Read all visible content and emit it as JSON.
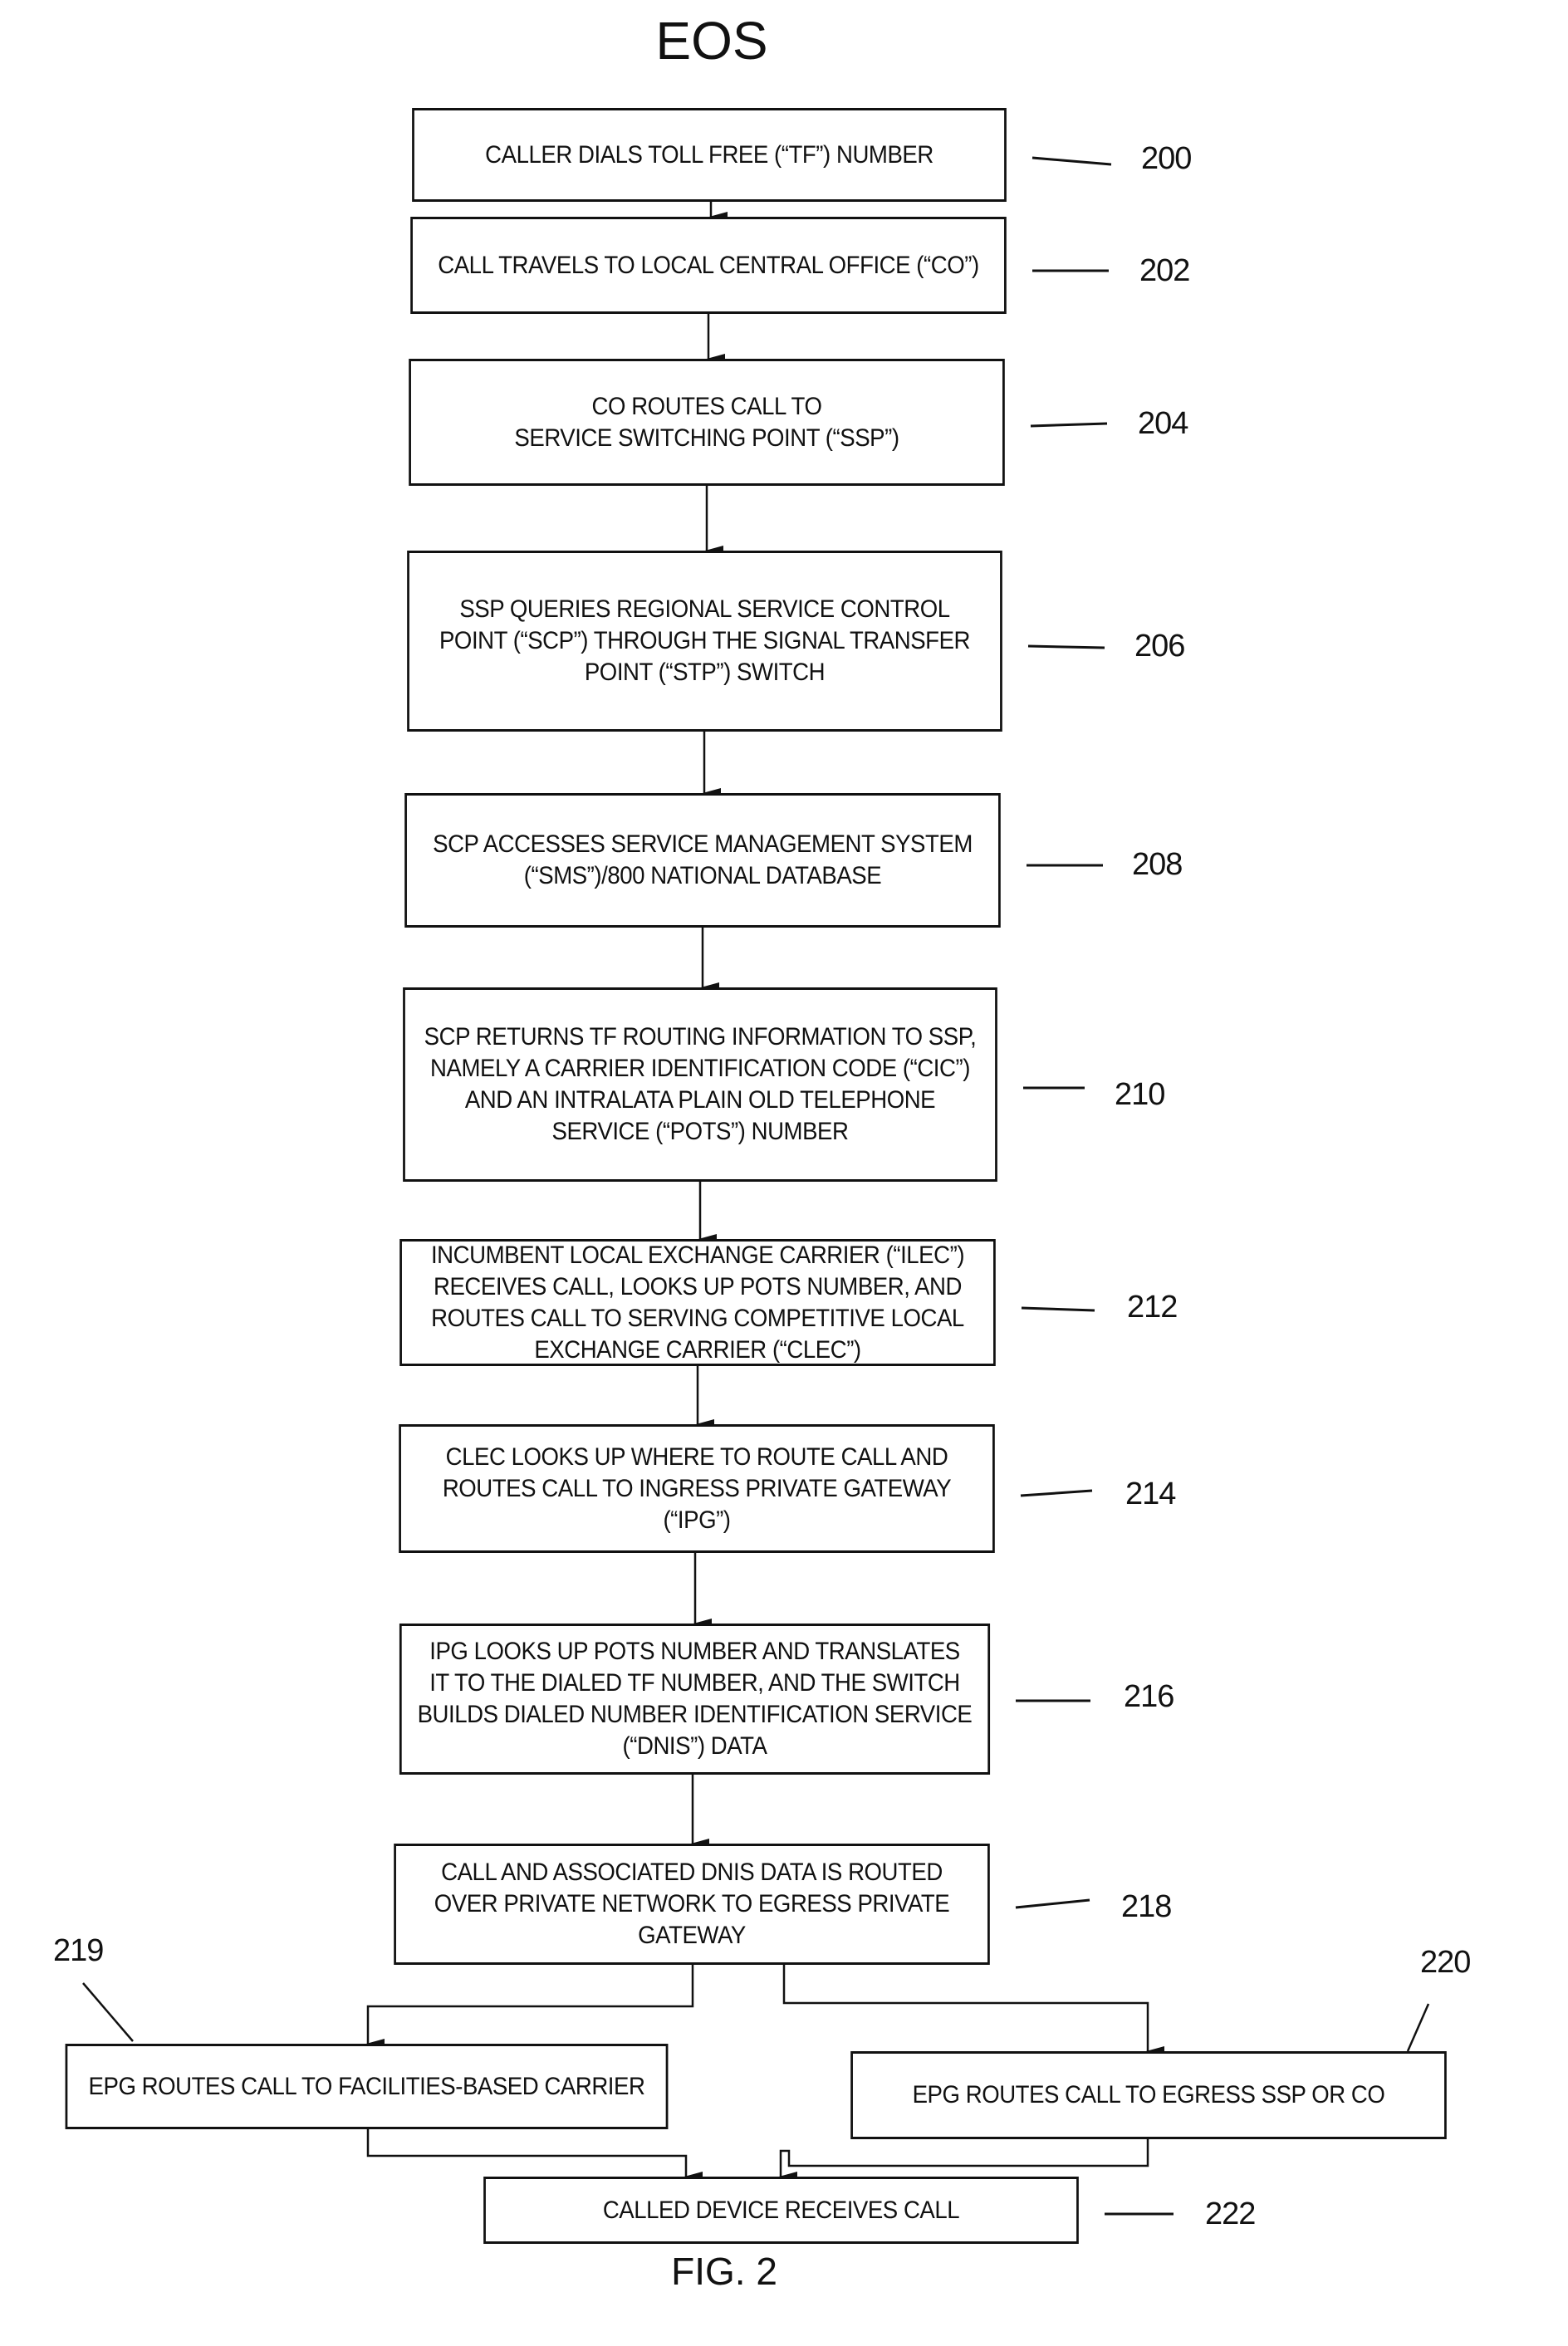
{
  "title": "EOS",
  "figure_label": "FIG. 2",
  "steps": [
    {
      "ref": "200",
      "text": "CALLER DIALS TOLL FREE (“TF”) NUMBER"
    },
    {
      "ref": "202",
      "text": "CALL TRAVELS TO LOCAL CENTRAL OFFICE (“CO”)"
    },
    {
      "ref": "204",
      "text": "CO ROUTES CALL TO\nSERVICE SWITCHING POINT (“SSP”)"
    },
    {
      "ref": "206",
      "text": "SSP QUERIES REGIONAL SERVICE CONTROL\nPOINT (“SCP”) THROUGH THE SIGNAL TRANSFER\nPOINT (“STP”) SWITCH"
    },
    {
      "ref": "208",
      "text": "SCP ACCESSES SERVICE MANAGEMENT SYSTEM\n(“SMS”)/800 NATIONAL DATABASE"
    },
    {
      "ref": "210",
      "text": "SCP RETURNS TF ROUTING INFORMATION TO SSP,\nNAMELY A CARRIER IDENTIFICATION CODE (“CIC”)\nAND AN INTRALATA PLAIN OLD TELEPHONE\nSERVICE (“POTS”) NUMBER"
    },
    {
      "ref": "212",
      "text": "INCUMBENT LOCAL EXCHANGE CARRIER (“ILEC”)\nRECEIVES CALL, LOOKS UP POTS NUMBER, AND\nROUTES CALL TO SERVING COMPETITIVE LOCAL\nEXCHANGE CARRIER (“CLEC”)"
    },
    {
      "ref": "214",
      "text": "CLEC LOOKS UP WHERE TO ROUTE CALL AND\nROUTES CALL TO INGRESS PRIVATE GATEWAY\n(“IPG”)"
    },
    {
      "ref": "216",
      "text": "IPG LOOKS UP POTS NUMBER AND TRANSLATES\nIT TO THE DIALED TF NUMBER, AND THE SWITCH\nBUILDS DIALED NUMBER IDENTIFICATION SERVICE\n(“DNIS”) DATA"
    },
    {
      "ref": "218",
      "text": "CALL AND ASSOCIATED DNIS DATA IS ROUTED\nOVER PRIVATE NETWORK TO EGRESS PRIVATE\nGATEWAY"
    },
    {
      "ref": "219",
      "text": "EPG ROUTES CALL TO FACILITIES-BASED CARRIER"
    },
    {
      "ref": "220",
      "text": "EPG ROUTES CALL TO EGRESS SSP OR CO"
    },
    {
      "ref": "222",
      "text": "CALLED DEVICE RECEIVES CALL"
    }
  ]
}
